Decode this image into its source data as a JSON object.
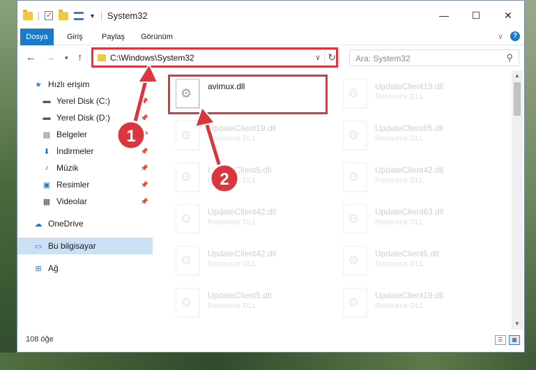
{
  "window": {
    "title": "System32"
  },
  "ribbon": {
    "tabs": [
      "Dosya",
      "Giriş",
      "Paylaş",
      "Görünüm"
    ],
    "help_icon": "help-icon",
    "help_label": "?"
  },
  "address": {
    "path": "C:\\Windows\\System32",
    "search_placeholder": "Ara: System32"
  },
  "nav": {
    "items": [
      {
        "label": "Hızlı erişim",
        "icon": "star-icon",
        "pinned": false
      },
      {
        "label": "Yerel Disk (C:)",
        "icon": "drive-icon",
        "pinned": true
      },
      {
        "label": "Yerel Disk (D:)",
        "icon": "drive-icon",
        "pinned": true
      },
      {
        "label": "Belgeler",
        "icon": "documents-icon",
        "pinned": true
      },
      {
        "label": "İndirmeler",
        "icon": "download-icon",
        "pinned": true
      },
      {
        "label": "Müzik",
        "icon": "music-icon",
        "pinned": true
      },
      {
        "label": "Resimler",
        "icon": "pictures-icon",
        "pinned": true
      },
      {
        "label": "Videolar",
        "icon": "video-icon",
        "pinned": true
      },
      {
        "label": "OneDrive",
        "icon": "cloud-icon",
        "pinned": false
      },
      {
        "label": "Bu bilgisayar",
        "icon": "computer-icon",
        "pinned": false,
        "selected": true
      },
      {
        "label": "Ağ",
        "icon": "network-icon",
        "pinned": false
      }
    ]
  },
  "files": [
    {
      "name": "avimux.dll",
      "type": "",
      "highlighted": true
    },
    {
      "name": "UpdateClient19.dll",
      "type": "Resource DLL"
    },
    {
      "name": "UpdateClient19.dll",
      "type": "Resource DLL"
    },
    {
      "name": "UpdateClient65.dll",
      "type": "Resource DLL"
    },
    {
      "name": "UpdateClient5.dll",
      "type": "Resource DLL"
    },
    {
      "name": "UpdateClient42.dll",
      "type": "Resource DLL"
    },
    {
      "name": "UpdateClient42.dll",
      "type": "Resource DLL"
    },
    {
      "name": "UpdateClient63.dll",
      "type": "Resource DLL"
    },
    {
      "name": "UpdateClient42.dll",
      "type": "Resource DLL"
    },
    {
      "name": "UpdateClient5.dll",
      "type": "Resource DLL"
    },
    {
      "name": "UpdateClient5.dll",
      "type": "Resource DLL"
    },
    {
      "name": "UpdateClient19.dll",
      "type": "Resource DLL"
    }
  ],
  "status": {
    "item_count": "108 öğe"
  },
  "annotations": {
    "step1": "1",
    "step2": "2",
    "highlight_color": "#d9363e"
  }
}
